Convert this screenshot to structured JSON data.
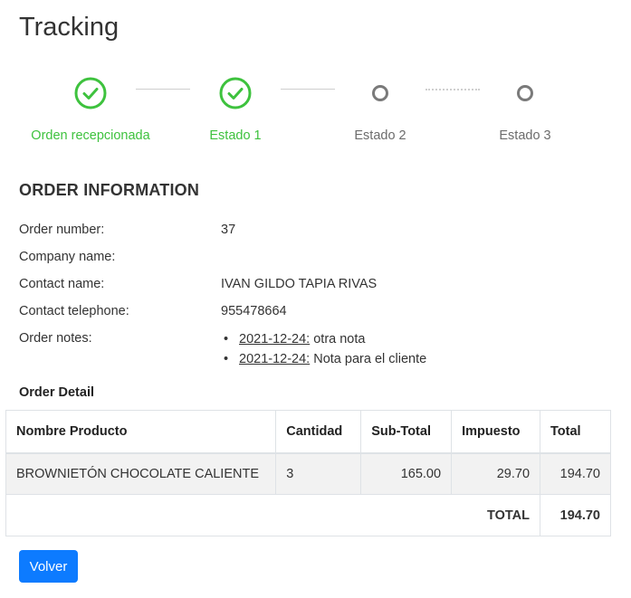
{
  "page": {
    "title": "Tracking"
  },
  "stepper": {
    "steps": [
      {
        "label": "Orden recepcionada",
        "status": "done"
      },
      {
        "label": "Estado 1",
        "status": "done"
      },
      {
        "label": "Estado 2",
        "status": "pending"
      },
      {
        "label": "Estado 3",
        "status": "pending"
      }
    ],
    "colors": {
      "done": "#3ec23e",
      "pending": "#7a7a7a"
    }
  },
  "order_info": {
    "title": "ORDER INFORMATION",
    "number_label": "Order number:",
    "number": "37",
    "company_label": "Company name:",
    "company": "",
    "contact_label": "Contact name:",
    "contact": "IVAN GILDO TAPIA RIVAS",
    "phone_label": "Contact telephone:",
    "phone": "955478664",
    "notes_label": "Order notes:",
    "notes": [
      {
        "date": "2021-12-24:",
        "text": " otra nota"
      },
      {
        "date": "2021-12-24:",
        "text": " Nota para el cliente"
      }
    ]
  },
  "order_detail": {
    "title": "Order Detail",
    "headers": {
      "product": "Nombre Producto",
      "qty": "Cantidad",
      "subtotal": "Sub-Total",
      "tax": "Impuesto",
      "total": "Total"
    },
    "rows": [
      {
        "product": "BROWNIETÓN CHOCOLATE CALIENTE",
        "qty": "3",
        "subtotal": "165.00",
        "tax": "29.70",
        "total": "194.70"
      }
    ],
    "grand_total_label": "TOTAL",
    "grand_total": "194.70"
  },
  "actions": {
    "back_label": "Volver",
    "back_color": "#0d7bff"
  }
}
